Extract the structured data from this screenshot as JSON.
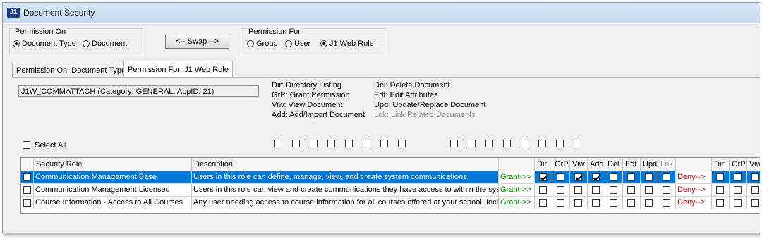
{
  "window": {
    "title": "Document Security",
    "icon_label": "J1"
  },
  "permission_on": {
    "legend": "Permission On",
    "options": [
      {
        "label": "Document Type",
        "selected": true
      },
      {
        "label": "Document",
        "selected": false
      }
    ]
  },
  "swap_button": "<-- Swap -->",
  "permission_for": {
    "legend": "Permission For",
    "options": [
      {
        "label": "Group",
        "selected": false
      },
      {
        "label": "User",
        "selected": false
      },
      {
        "label": "J1 Web Role",
        "selected": true
      }
    ]
  },
  "tabs": [
    {
      "label": "Permission On: Document Type",
      "active": false
    },
    {
      "label": "Permission For: J1 Web Role",
      "active": true
    }
  ],
  "selected_item": "J1W_COMMATTACH (Category: GENERAL, AppID: 21)",
  "legend_codes": [
    {
      "code": "Dir:",
      "desc": "Directory Listing"
    },
    {
      "code": "GrP:",
      "desc": "Grant Permission"
    },
    {
      "code": "Viw:",
      "desc": "View Document"
    },
    {
      "code": "Add:",
      "desc": "Add/Import Document"
    },
    {
      "code": "Del:",
      "desc": "Delete Document"
    },
    {
      "code": "Edt:",
      "desc": "Edit Attributes"
    },
    {
      "code": "Upd:",
      "desc": "Update/Replace Document"
    },
    {
      "code": "Lnk:",
      "desc": "Link Related Documents",
      "disabled": true
    }
  ],
  "select_all": "Select All",
  "columns": {
    "role": "Security Role",
    "description": "Description",
    "grant_perms": [
      "Dir",
      "GrP",
      "Viw",
      "Add",
      "Del",
      "Edt",
      "Upd",
      "Lnk"
    ],
    "deny_perms": [
      "Dir",
      "GrP",
      "Viw"
    ]
  },
  "rows": [
    {
      "role": "Communication Management Base",
      "description": "Users in this role can define, manage, view, and create system communications.",
      "grant_label": "Grant->>",
      "deny_label": "Deny-->",
      "grant_checked": [
        true,
        false,
        true,
        true,
        false,
        false,
        false,
        false
      ],
      "selected": true
    },
    {
      "role": "Communication Management Licensed",
      "description": "Users in this role can view and create communications they have access to within the system",
      "grant_label": "Grant->>",
      "deny_label": "Deny-->",
      "grant_checked": [
        false,
        false,
        false,
        false,
        false,
        false,
        false,
        false
      ],
      "selected": false
    },
    {
      "role": "Course Information - Access to All Courses",
      "description": "Any user needing access to course information for all courses offered at your school. Include",
      "grant_label": "Grant->>",
      "deny_label": "Deny-->",
      "grant_checked": [
        false,
        false,
        false,
        false,
        false,
        false,
        false,
        false
      ],
      "selected": false
    }
  ]
}
